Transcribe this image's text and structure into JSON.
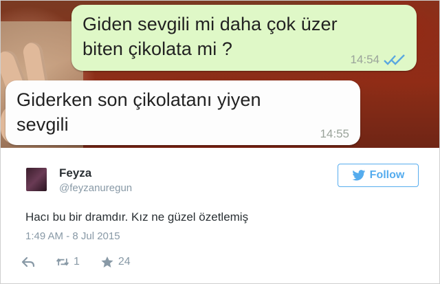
{
  "chat": {
    "outgoing": {
      "text": "Giden sevgili mi daha çok üzer\nbiten çikolata mi ?",
      "time": "14:54",
      "status_icon": "double-check-icon"
    },
    "incoming": {
      "text": "Giderken son çikolatanı yiyen\nsevgili",
      "time": "14:55"
    }
  },
  "tweet": {
    "name": "Feyza",
    "handle": "@feyzanuregun",
    "follow_label": "Follow",
    "text": "Hacı bu bir dramdır. Kız ne güzel özetlemiş",
    "timestamp": "1:49 AM - 8 Jul 2015",
    "retweet_count": "1",
    "favorite_count": "24",
    "accent_color": "#55acee"
  }
}
